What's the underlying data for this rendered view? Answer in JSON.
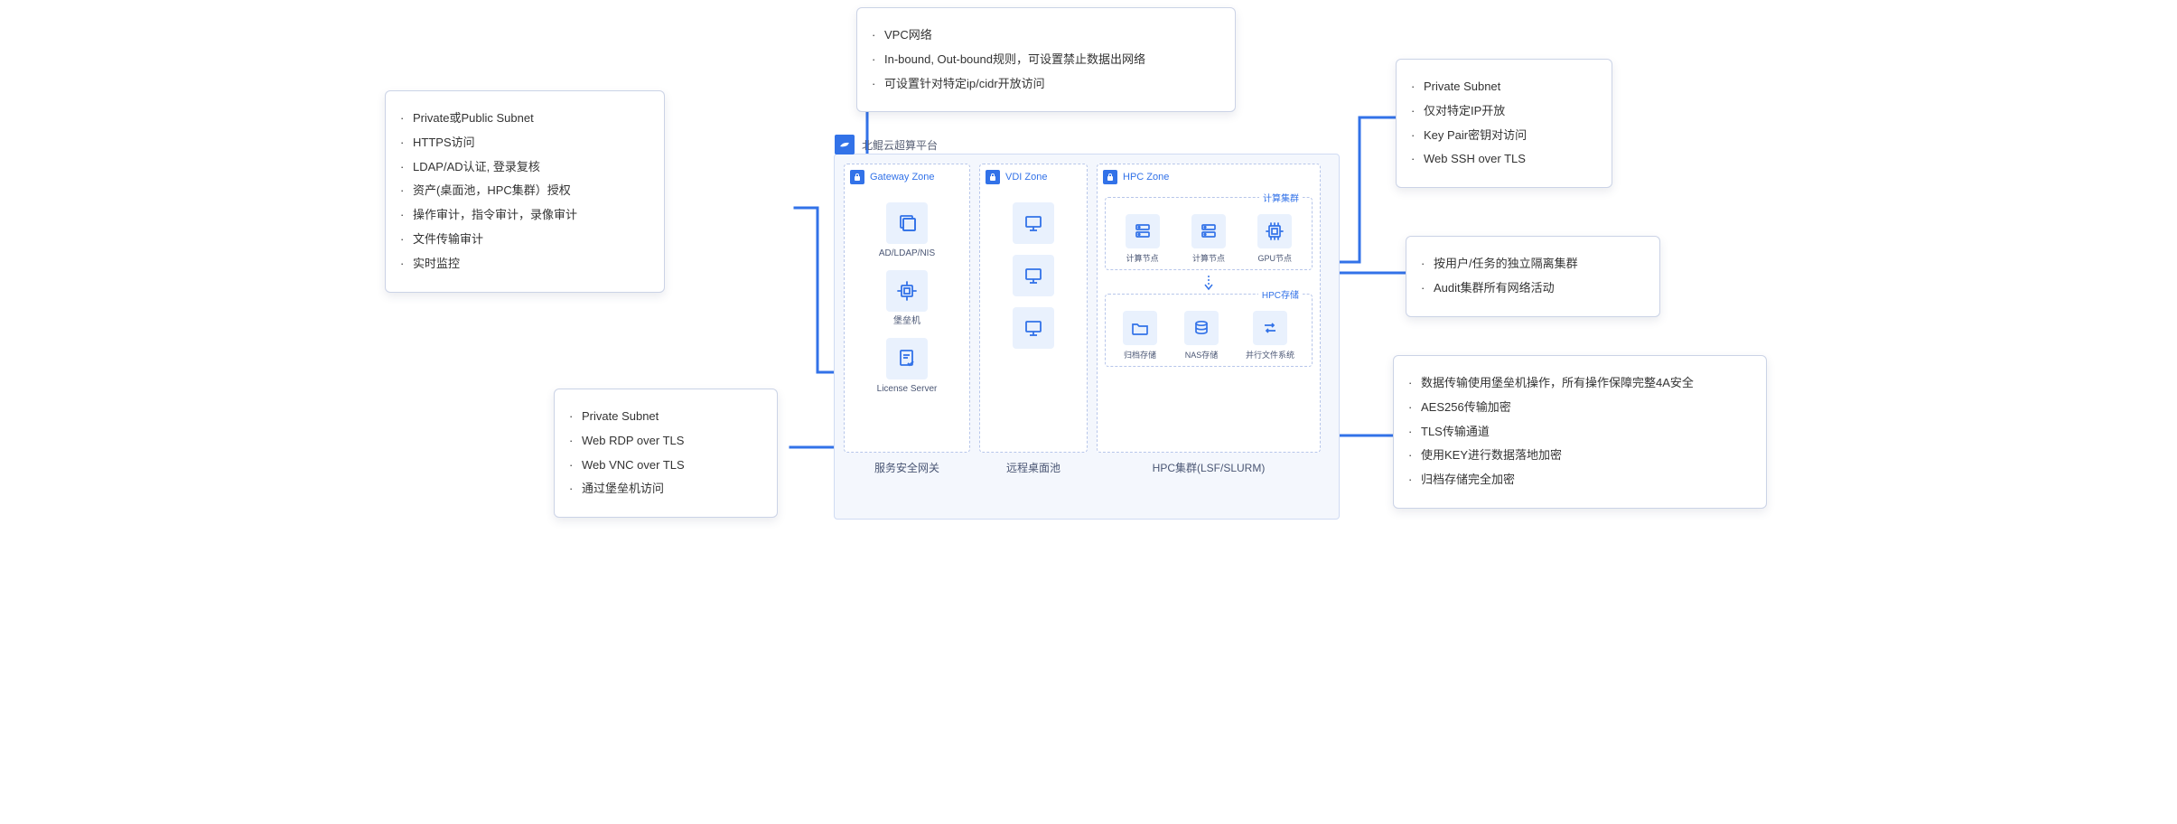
{
  "top_card": {
    "items": [
      "VPC网络",
      "In-bound, Out-bound规则，可设置禁止数据出网络",
      "可设置针对特定ip/cidr开放访问"
    ]
  },
  "left_big": {
    "items": [
      "Private或Public Subnet",
      "HTTPS访问",
      "LDAP/AD认证, 登录复核",
      "资产(桌面池，HPC集群）授权",
      "操作审计，指令审计，录像审计",
      "文件传输审计",
      "实时监控"
    ]
  },
  "left_small": {
    "items": [
      "Private Subnet",
      "Web RDP over TLS",
      "Web VNC over  TLS",
      "通过堡垒机访问"
    ]
  },
  "right_top": {
    "items": [
      "Private Subnet",
      "仅对特定IP开放",
      "Key Pair密钥对访问",
      "Web SSH over TLS"
    ]
  },
  "right_mid": {
    "items": [
      "按用户/任务的独立隔离集群",
      "Audit集群所有网络活动"
    ]
  },
  "right_big": {
    "items": [
      "数据传输使用堡垒机操作，所有操作保障完整4A安全",
      "AES256传输加密",
      "TLS传输通道",
      "使用KEY进行数据落地加密",
      "归档存储完全加密"
    ]
  },
  "platform": {
    "title": "北鲲云超算平台"
  },
  "zones": {
    "gateway": {
      "title": "Gateway Zone",
      "n0": "AD/LDAP/NIS",
      "n1": "堡垒机",
      "n2": "License Server",
      "label": "服务安全网关"
    },
    "vdi": {
      "title": "VDI Zone",
      "label": "远程桌面池"
    },
    "hpc": {
      "title": "HPC Zone",
      "compute_title": "计算集群",
      "compute": {
        "c0": "计算节点",
        "c1": "计算节点",
        "c2": "GPU节点"
      },
      "storage_title": "HPC存储",
      "storage": {
        "s0": "归档存储",
        "s1": "NAS存储",
        "s2": "并行文件系统"
      },
      "label": "HPC集群(LSF/SLURM)"
    }
  }
}
